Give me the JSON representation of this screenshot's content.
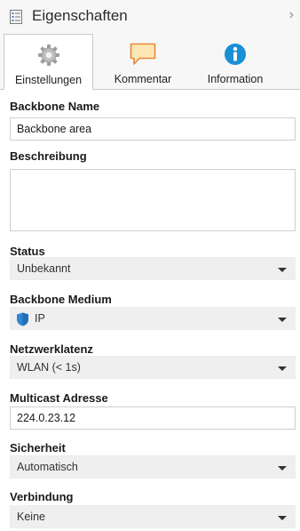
{
  "header": {
    "title": "Eigenschaften",
    "chevron": "›",
    "icon": "properties-icon"
  },
  "tabs": [
    {
      "label": "Einstellungen",
      "icon": "gear-icon",
      "active": true
    },
    {
      "label": "Kommentar",
      "icon": "comment-icon",
      "active": false
    },
    {
      "label": "Information",
      "icon": "info-icon",
      "active": false
    }
  ],
  "form": {
    "backbone_name": {
      "label": "Backbone Name",
      "value": "Backbone area"
    },
    "beschreibung": {
      "label": "Beschreibung",
      "value": ""
    },
    "status": {
      "label": "Status",
      "value": "Unbekannt"
    },
    "backbone_medium": {
      "label": "Backbone Medium",
      "value": "IP",
      "icon": "shield-icon"
    },
    "netzwerklatenz": {
      "label": "Netzwerklatenz",
      "value": "WLAN (< 1s)"
    },
    "multicast": {
      "label": "Multicast Adresse",
      "value": "224.0.23.12"
    },
    "sicherheit": {
      "label": "Sicherheit",
      "value": "Automatisch"
    },
    "verbindung": {
      "label": "Verbindung",
      "value": "Keine"
    }
  },
  "colors": {
    "info_blue": "#1a8fd6",
    "shield_blue": "#2f86d2",
    "comment_orange": "#e8893a",
    "comment_fill": "#fde7b5"
  }
}
